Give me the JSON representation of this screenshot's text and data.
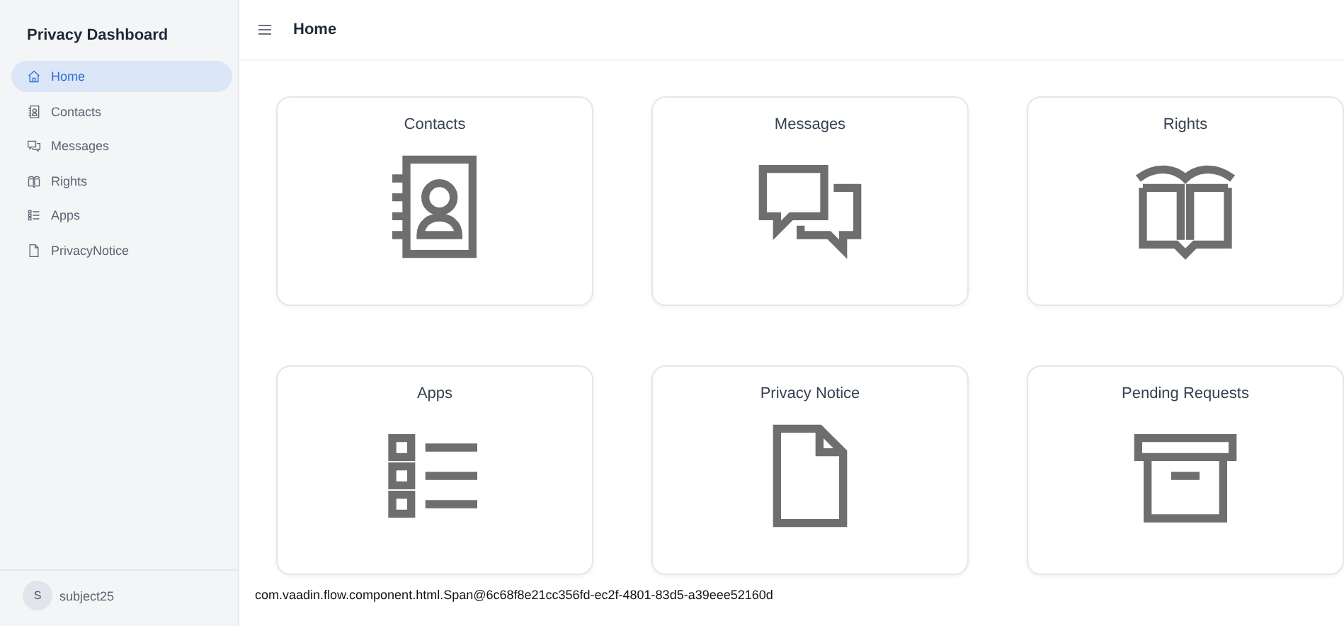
{
  "sidebar": {
    "title": "Privacy Dashboard",
    "items": [
      {
        "label": "Home",
        "kind": "home",
        "selected": true
      },
      {
        "label": "Contacts",
        "kind": "contacts",
        "selected": false
      },
      {
        "label": "Messages",
        "kind": "messages",
        "selected": false
      },
      {
        "label": "Rights",
        "kind": "rights",
        "selected": false
      },
      {
        "label": "Apps",
        "kind": "apps",
        "selected": false
      },
      {
        "label": "PrivacyNotice",
        "kind": "notice",
        "selected": false
      }
    ],
    "user": {
      "initial": "S",
      "name": "subject25"
    }
  },
  "header": {
    "title": "Home"
  },
  "cards": [
    {
      "title": "Contacts",
      "kind": "contacts"
    },
    {
      "title": "Messages",
      "kind": "messages"
    },
    {
      "title": "Rights",
      "kind": "rights"
    },
    {
      "title": "Apps",
      "kind": "apps"
    },
    {
      "title": "Privacy Notice",
      "kind": "notice"
    },
    {
      "title": "Pending Requests",
      "kind": "archive"
    }
  ],
  "footer_text": "com.vaadin.flow.component.html.Span@6c68f8e21cc356fd-ec2f-4801-83d5-a39eee52160d"
}
